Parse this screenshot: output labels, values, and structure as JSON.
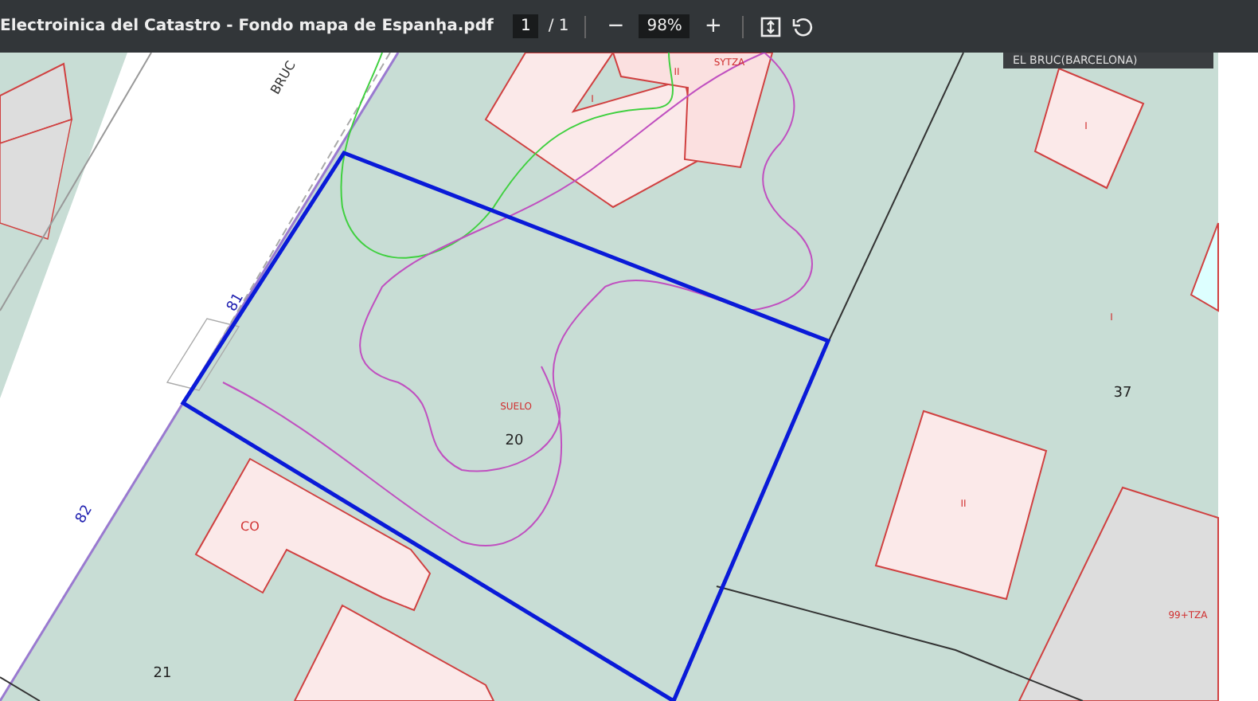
{
  "toolbar": {
    "title": "Electroinica del Catastro - Fondo mapa de Espanḥa.pdf",
    "page": "1",
    "page_total": "/ 1",
    "zoom_out": "−",
    "zoom": "98%",
    "zoom_in": "+"
  },
  "map": {
    "overlay": "EL BRUC(BARCELONA)",
    "labels": [
      {
        "text": "BRUC",
        "kind": "street"
      },
      {
        "text": "81",
        "kind": "number"
      },
      {
        "text": "82",
        "kind": "number"
      },
      {
        "text": "I",
        "kind": "building"
      },
      {
        "text": "II",
        "kind": "building"
      },
      {
        "text": "SYTZA",
        "kind": "building"
      },
      {
        "text": "SUELO",
        "kind": "building"
      },
      {
        "text": "20",
        "kind": "parcel"
      },
      {
        "text": "I",
        "kind": "building"
      },
      {
        "text": "I",
        "kind": "building"
      },
      {
        "text": "37",
        "kind": "parcel"
      },
      {
        "text": "CO",
        "kind": "building"
      },
      {
        "text": "II",
        "kind": "building"
      },
      {
        "text": "99+TZA",
        "kind": "building"
      },
      {
        "text": "21",
        "kind": "parcel"
      }
    ]
  }
}
